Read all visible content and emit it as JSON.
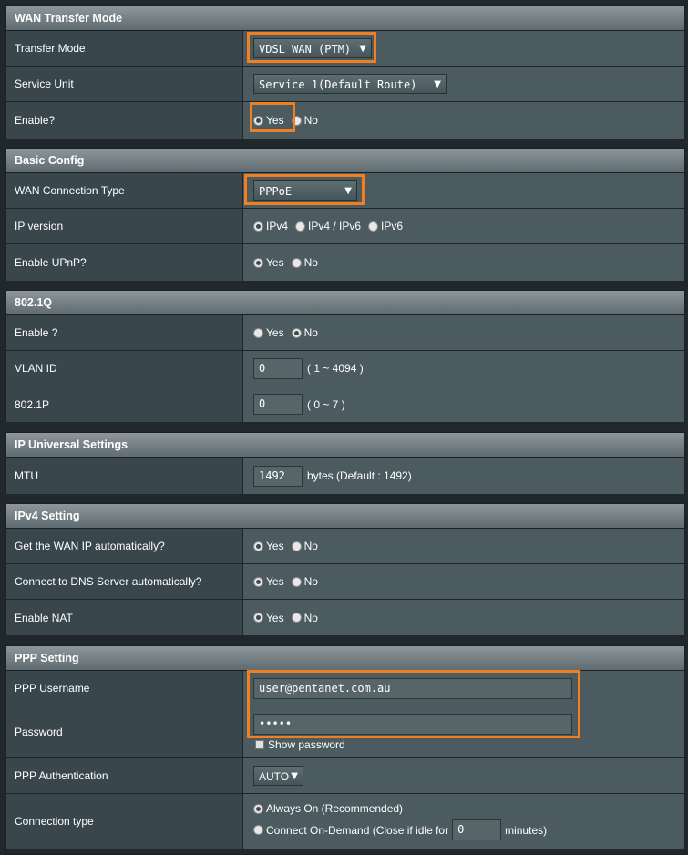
{
  "wan": {
    "title": "WAN Transfer Mode",
    "transfer_mode_label": "Transfer Mode",
    "transfer_mode_value": "VDSL WAN (PTM)",
    "service_unit_label": "Service Unit",
    "service_unit_value": "Service 1(Default Route)",
    "enable_label": "Enable?",
    "yes": "Yes",
    "no": "No"
  },
  "basic": {
    "title": "Basic Config",
    "conn_type_label": "WAN Connection Type",
    "conn_type_value": "PPPoE",
    "ip_version_label": "IP version",
    "ipv4": "IPv4",
    "ipv4v6": "IPv4 / IPv6",
    "ipv6": "IPv6",
    "upnp_label": "Enable UPnP?",
    "yes": "Yes",
    "no": "No"
  },
  "dot1q": {
    "title": "802.1Q",
    "enable_label": "Enable ?",
    "yes": "Yes",
    "no": "No",
    "vlan_label": "VLAN ID",
    "vlan_value": "0",
    "vlan_hint": "( 1 ~ 4094 )",
    "p_label": "802.1P",
    "p_value": "0",
    "p_hint": "( 0 ~ 7 )"
  },
  "universal": {
    "title": "IP Universal Settings",
    "mtu_label": "MTU",
    "mtu_value": "1492",
    "mtu_hint": "bytes (Default : 1492)"
  },
  "ipv4": {
    "title": "IPv4 Setting",
    "wanip_label": "Get the WAN IP automatically?",
    "dns_label": "Connect to DNS Server automatically?",
    "nat_label": "Enable NAT",
    "yes": "Yes",
    "no": "No"
  },
  "ppp": {
    "title": "PPP Setting",
    "username_label": "PPP Username",
    "username_value": "user@pentanet.com.au",
    "password_label": "Password",
    "password_value": "•••••",
    "show_password": "Show password",
    "auth_label": "PPP Authentication",
    "auth_value": "AUTO",
    "conn_label": "Connection type",
    "always_on": "Always On (Recommended)",
    "on_demand": "Connect On-Demand (Close if idle for",
    "idle_value": "0",
    "minutes": "minutes)"
  },
  "colors": {
    "highlight": "#f07f22",
    "header": "#6f7a7f",
    "label_bg": "#39474d",
    "value_bg": "#4b5b60"
  }
}
